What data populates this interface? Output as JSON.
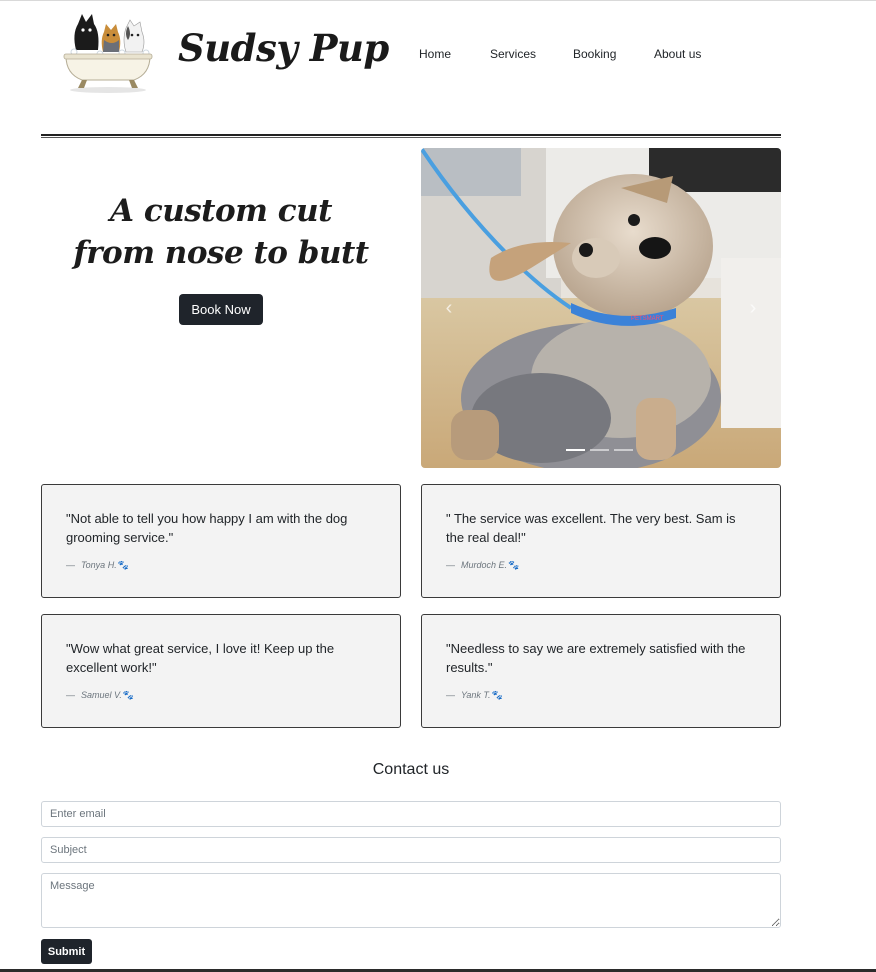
{
  "header": {
    "brand": "Sudsy Pup",
    "logo": "dogs-in-bathtub-logo",
    "nav": [
      "Home",
      "Services",
      "Booking",
      "About us"
    ]
  },
  "hero": {
    "title_line1": "A custom cut",
    "title_line2": "from nose to butt",
    "cta_label": "Book Now"
  },
  "carousel": {
    "image": "yorkie-dog-photo",
    "prev_icon": "chevron-left-icon",
    "next_icon": "chevron-right-icon",
    "slide_count": 3,
    "active_slide": 1
  },
  "testimonials": [
    {
      "quote": "\"Not able to tell you how happy I am with the dog grooming service.\"",
      "author": "Tonya H."
    },
    {
      "quote": "\" The service was excellent. The very best. Sam is the real deal!\"",
      "author": "Murdoch E."
    },
    {
      "quote": "\"Wow what great service, I love it! Keep up the excellent work!\"",
      "author": "Samuel V."
    },
    {
      "quote": "\"Needless to say we are extremely satisfied with the results.\"",
      "author": "Yank T."
    }
  ],
  "contact": {
    "title": "Contact us",
    "email_placeholder": "Enter email",
    "subject_placeholder": "Subject",
    "message_placeholder": "Message",
    "submit_label": "Submit"
  },
  "colors": {
    "button_bg": "#1f242b",
    "card_bg": "#f3f3f3",
    "card_border": "#3a3a3a"
  }
}
